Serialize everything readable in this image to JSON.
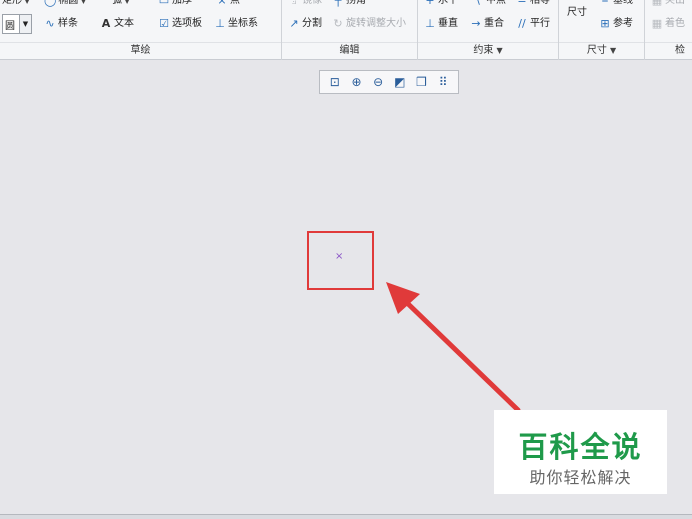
{
  "ribbon": {
    "sketch": {
      "label": "草绘",
      "row1": [
        "矩形",
        "椭圆",
        "弧",
        "加厚",
        "点"
      ],
      "circle": "圆",
      "spline": "样条",
      "text": "文本",
      "palette": "选项板",
      "coord": "坐标系"
    },
    "edit": {
      "label": "编辑",
      "mirror": "镜像",
      "divide": "拐角",
      "split": "分割",
      "rotate": "旋转调整大小"
    },
    "constraint": {
      "label": "约束",
      "horizontal": "水平",
      "midpoint": "中点",
      "equal": "相等",
      "vertical": "垂直",
      "coincident": "重合",
      "parallel": "平行"
    },
    "dimension": {
      "label": "尺寸",
      "dim": "尺寸",
      "baseline": "基线",
      "reference": "参考"
    },
    "inspect": {
      "label": "检",
      "item1": "突出",
      "item2": "着色"
    }
  },
  "watermark": {
    "title": "百科全说",
    "subtitle": "助你轻松解决"
  },
  "canvas": {
    "point_marker": "×"
  },
  "colors": {
    "highlight": "#e03a3a",
    "watermark_green": "#1f9a4a"
  }
}
